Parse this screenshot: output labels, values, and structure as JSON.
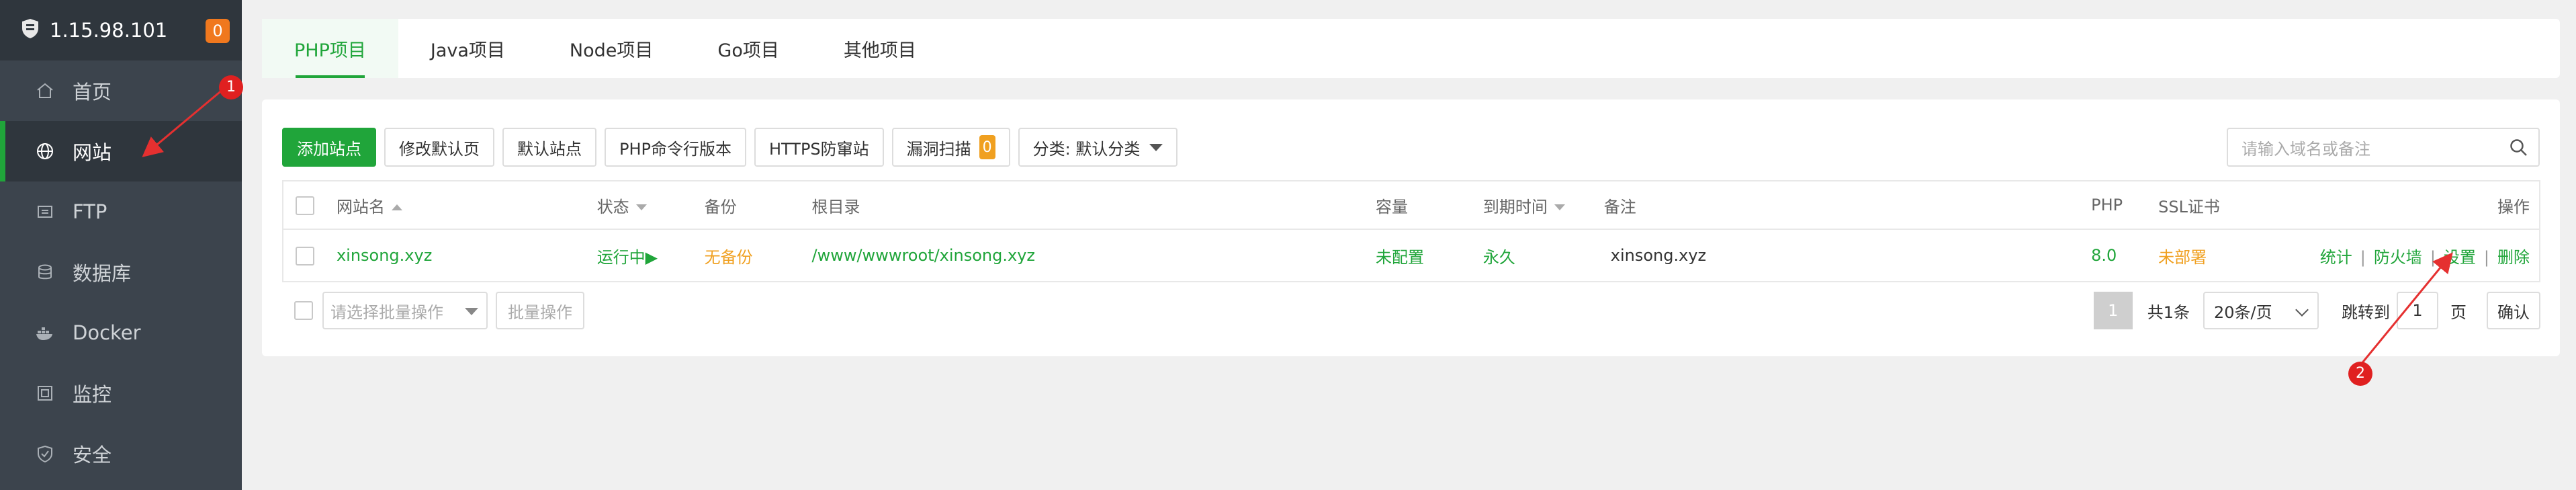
{
  "sidebar": {
    "server_ip": "1.15.98.101",
    "notification_count": "0",
    "items": [
      {
        "label": "首页",
        "icon": "home-icon"
      },
      {
        "label": "网站",
        "icon": "globe-icon"
      },
      {
        "label": "FTP",
        "icon": "ftp-icon"
      },
      {
        "label": "数据库",
        "icon": "database-icon"
      },
      {
        "label": "Docker",
        "icon": "docker-icon"
      },
      {
        "label": "监控",
        "icon": "monitor-icon"
      },
      {
        "label": "安全",
        "icon": "shield-icon"
      }
    ]
  },
  "tabs": [
    "PHP项目",
    "Java项目",
    "Node项目",
    "Go项目",
    "其他项目"
  ],
  "toolbar": {
    "add_site": "添加站点",
    "modify_default_page": "修改默认页",
    "default_site": "默认站点",
    "php_cli_version": "PHP命令行版本",
    "https_protection": "HTTPS防窜站",
    "vuln_scan": "漏洞扫描",
    "vuln_count": "0",
    "category": "分类: 默认分类"
  },
  "search": {
    "placeholder": "请输入域名或备注"
  },
  "table": {
    "headers": {
      "name": "网站名",
      "status": "状态",
      "backup": "备份",
      "root": "根目录",
      "capacity": "容量",
      "expire": "到期时间",
      "note": "备注",
      "php": "PHP",
      "ssl": "SSL证书",
      "actions": "操作"
    },
    "rows": [
      {
        "name": "xinsong.xyz",
        "status": "运行中▶",
        "backup": "无备份",
        "root": "/www/wwwroot/xinsong.xyz",
        "capacity": "未配置",
        "expire": "永久",
        "note": "xinsong.xyz",
        "php": "8.0",
        "ssl": "未部署",
        "actions": {
          "stats": "统计",
          "firewall": "防火墙",
          "settings": "设置",
          "delete": "删除",
          "sep": "|"
        }
      }
    ]
  },
  "footer": {
    "batch_placeholder": "请选择批量操作",
    "batch_button": "批量操作",
    "pager": {
      "current_page": "1",
      "total": "共1条",
      "page_size": "20条/页",
      "jump_label": "跳转到",
      "jump_value": "1",
      "page_unit": "页",
      "confirm": "确认"
    }
  },
  "annotations": {
    "marker_1": "1",
    "marker_2": "2"
  },
  "colors": {
    "accent": "#20a53a",
    "warning": "#f0a020",
    "sidebar_bg": "#3c444d",
    "marker": "#e02020"
  }
}
